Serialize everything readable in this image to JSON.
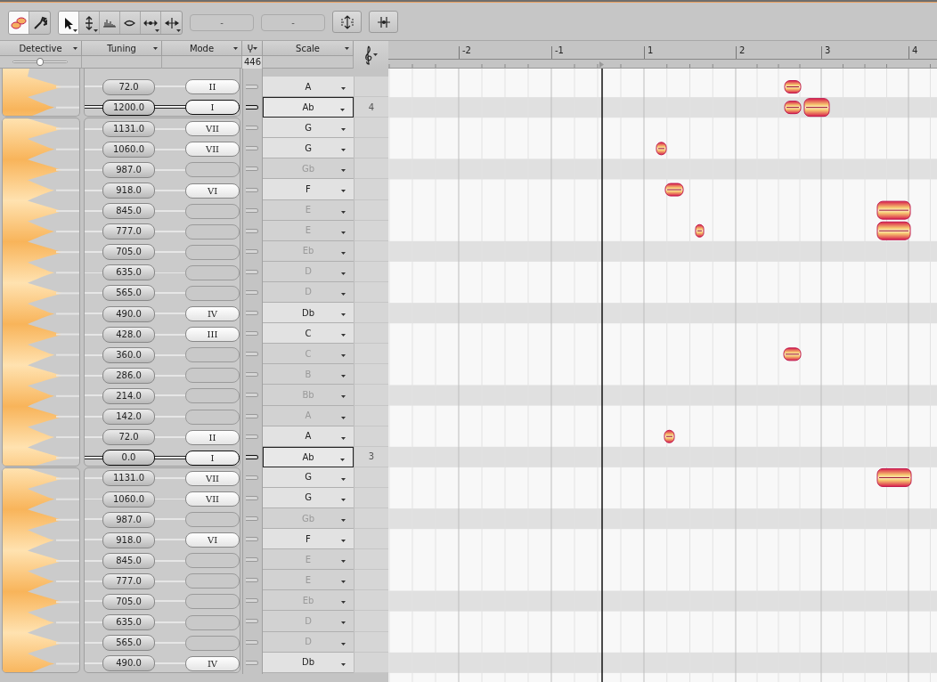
{
  "toolbar": {
    "modes": [
      {
        "kind": "blob",
        "selected": true
      },
      {
        "kind": "wrench",
        "selected": false
      }
    ],
    "tools": [
      {
        "kind": "pointer",
        "selected": true,
        "menu": true
      },
      {
        "kind": "pitch",
        "selected": false,
        "menu": true
      },
      {
        "kind": "formant",
        "selected": false,
        "menu": false
      },
      {
        "kind": "amplitude",
        "selected": false,
        "menu": false
      },
      {
        "kind": "timing",
        "selected": false,
        "menu": true
      },
      {
        "kind": "time-handle",
        "selected": false,
        "menu": true
      }
    ],
    "fields": [
      "-",
      "-"
    ],
    "actions": [
      {
        "kind": "pitch-align"
      },
      {
        "kind": "time-align"
      }
    ]
  },
  "headers": [
    "Detective",
    "Tuning",
    "Mode",
    "Scale"
  ],
  "detective": {
    "level": 0.5
  },
  "reference_pitch": "446",
  "ruler": [
    "-2",
    "-1",
    "1",
    "2",
    "3",
    "4"
  ],
  "rows": [
    {
      "tuning": "72.0",
      "mode": "II",
      "note": "A",
      "enabled": true,
      "root": false,
      "black_key": false
    },
    {
      "tuning": "1200.0",
      "mode": "I",
      "note": "Ab",
      "enabled": true,
      "root": true,
      "octave": "4",
      "black_key": true
    },
    {
      "tuning": "1131.0",
      "mode": "VII",
      "note": "G",
      "enabled": true,
      "root": false,
      "black_key": false
    },
    {
      "tuning": "1060.0",
      "mode": "VII",
      "note": "G",
      "enabled": true,
      "root": false,
      "black_key": false
    },
    {
      "tuning": "987.0",
      "note": "Gb",
      "enabled": false,
      "root": false,
      "black_key": true
    },
    {
      "tuning": "918.0",
      "mode": "VI",
      "note": "F",
      "enabled": true,
      "root": false,
      "black_key": false
    },
    {
      "tuning": "845.0",
      "note": "E",
      "enabled": false,
      "root": false,
      "black_key": false
    },
    {
      "tuning": "777.0",
      "note": "E",
      "enabled": false,
      "root": false,
      "black_key": false
    },
    {
      "tuning": "705.0",
      "note": "Eb",
      "enabled": false,
      "root": false,
      "black_key": true
    },
    {
      "tuning": "635.0",
      "note": "D",
      "enabled": false,
      "root": false,
      "black_key": false
    },
    {
      "tuning": "565.0",
      "note": "D",
      "enabled": false,
      "root": false,
      "black_key": false
    },
    {
      "tuning": "490.0",
      "mode": "IV",
      "note": "Db",
      "enabled": true,
      "root": false,
      "black_key": true
    },
    {
      "tuning": "428.0",
      "mode": "III",
      "note": "C",
      "enabled": true,
      "root": false,
      "black_key": false
    },
    {
      "tuning": "360.0",
      "note": "C",
      "enabled": false,
      "root": false,
      "black_key": false
    },
    {
      "tuning": "286.0",
      "note": "B",
      "enabled": false,
      "root": false,
      "black_key": false
    },
    {
      "tuning": "214.0",
      "note": "Bb",
      "enabled": false,
      "root": false,
      "black_key": true
    },
    {
      "tuning": "142.0",
      "note": "A",
      "enabled": false,
      "root": false,
      "black_key": false
    },
    {
      "tuning": "72.0",
      "mode": "II",
      "note": "A",
      "enabled": true,
      "root": false,
      "black_key": false
    },
    {
      "tuning": "0.0",
      "mode": "I",
      "note": "Ab",
      "enabled": true,
      "root": true,
      "octave": "3",
      "black_key": true
    },
    {
      "tuning": "1131.0",
      "mode": "VII",
      "note": "G",
      "enabled": true,
      "root": false,
      "black_key": false
    },
    {
      "tuning": "1060.0",
      "mode": "VII",
      "note": "G",
      "enabled": true,
      "root": false,
      "black_key": false
    },
    {
      "tuning": "987.0",
      "note": "Gb",
      "enabled": false,
      "root": false,
      "black_key": true
    },
    {
      "tuning": "918.0",
      "mode": "VI",
      "note": "F",
      "enabled": true,
      "root": false,
      "black_key": false
    },
    {
      "tuning": "845.0",
      "note": "E",
      "enabled": false,
      "root": false,
      "black_key": false
    },
    {
      "tuning": "777.0",
      "note": "E",
      "enabled": false,
      "root": false,
      "black_key": false
    },
    {
      "tuning": "705.0",
      "note": "Eb",
      "enabled": false,
      "root": false,
      "black_key": true
    },
    {
      "tuning": "635.0",
      "note": "D",
      "enabled": false,
      "root": false,
      "black_key": false
    },
    {
      "tuning": "565.0",
      "note": "D",
      "enabled": false,
      "root": false,
      "black_key": false
    },
    {
      "tuning": "490.0",
      "mode": "IV",
      "note": "Db",
      "enabled": true,
      "root": false,
      "black_key": true
    }
  ]
}
